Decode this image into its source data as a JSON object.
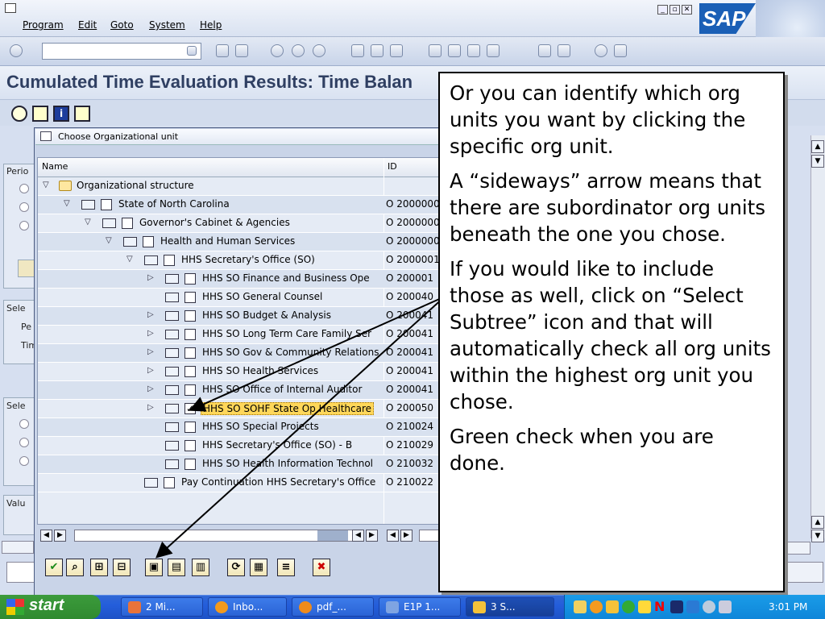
{
  "menus": [
    "Program",
    "Edit",
    "Goto",
    "System",
    "Help"
  ],
  "title": "Cumulated Time Evaluation Results: Time Balan",
  "bg_labels": [
    "Perio",
    "Sele",
    "Pe",
    "Tim",
    "Sele",
    "Valu"
  ],
  "popup": {
    "title": "Choose Organizational unit",
    "col_name": "Name",
    "col_id": "ID",
    "rows": [
      {
        "name": "Organizational structure",
        "id": "",
        "indent": 0,
        "toggle": "open",
        "kind": "folder"
      },
      {
        "name": "State of North Carolina",
        "id": "O  2000000",
        "indent": 1,
        "toggle": "open",
        "kind": "org"
      },
      {
        "name": "Governor's Cabinet & Agencies",
        "id": "O  2000000",
        "indent": 2,
        "toggle": "open",
        "kind": "org"
      },
      {
        "name": "Health and Human Services",
        "id": "O  2000000",
        "indent": 3,
        "toggle": "open",
        "kind": "org"
      },
      {
        "name": "HHS Secretary's Office (SO)",
        "id": "O  2000001",
        "indent": 4,
        "toggle": "open",
        "kind": "org"
      },
      {
        "name": "HHS SO Finance and Business Ope",
        "id": "O  200001",
        "indent": 5,
        "toggle": "closed",
        "kind": "org"
      },
      {
        "name": "HHS SO General Counsel",
        "id": "O  200040",
        "indent": 5,
        "toggle": "none",
        "kind": "org"
      },
      {
        "name": "HHS SO Budget & Analysis",
        "id": "O  200041",
        "indent": 5,
        "toggle": "closed",
        "kind": "org"
      },
      {
        "name": "HHS SO Long Term Care Family Ser",
        "id": "O  200041",
        "indent": 5,
        "toggle": "closed",
        "kind": "org"
      },
      {
        "name": "HHS SO Gov & Community Relations",
        "id": "O  200041",
        "indent": 5,
        "toggle": "closed",
        "kind": "org"
      },
      {
        "name": "HHS SO Health Services",
        "id": "O  200041",
        "indent": 5,
        "toggle": "closed",
        "kind": "org"
      },
      {
        "name": "HHS SO Office of Internal Auditor",
        "id": "O  200041",
        "indent": 5,
        "toggle": "closed",
        "kind": "org"
      },
      {
        "name": "HHS SO SOHF State Op Healthcare",
        "id": "O  200050",
        "indent": 5,
        "toggle": "closed",
        "kind": "org",
        "checked": true,
        "selected": true
      },
      {
        "name": "HHS SO Special Projects",
        "id": "O  210024",
        "indent": 5,
        "toggle": "none",
        "kind": "org"
      },
      {
        "name": "HHS Secretary's Office (SO) - B",
        "id": "O  210029",
        "indent": 5,
        "toggle": "none",
        "kind": "org"
      },
      {
        "name": "HHS SO Health Information Technol",
        "id": "O  210032",
        "indent": 5,
        "toggle": "none",
        "kind": "org"
      },
      {
        "name": "Pay Continuation HHS Secretary's Office",
        "id": "O  210022",
        "indent": 4,
        "toggle": "none",
        "kind": "org"
      }
    ]
  },
  "callout": {
    "p1": "Or you can identify which org units you want by clicking the specific org unit.",
    "p2": "A “sideways” arrow means that there are subordinator org units beneath the one you chose.",
    "p3": "If you would like to include those as well, click on “Select Subtree” icon and that will automatically check all org units within the highest org unit you chose.",
    "p4": "Green check when you are done."
  },
  "taskbar": {
    "start": "start",
    "tasks": [
      "2 Mi...",
      "Inbo...",
      "pdf_...",
      "E1P 1...",
      "3 S..."
    ],
    "clock": "3:01 PM"
  },
  "logo_text": "SAP"
}
